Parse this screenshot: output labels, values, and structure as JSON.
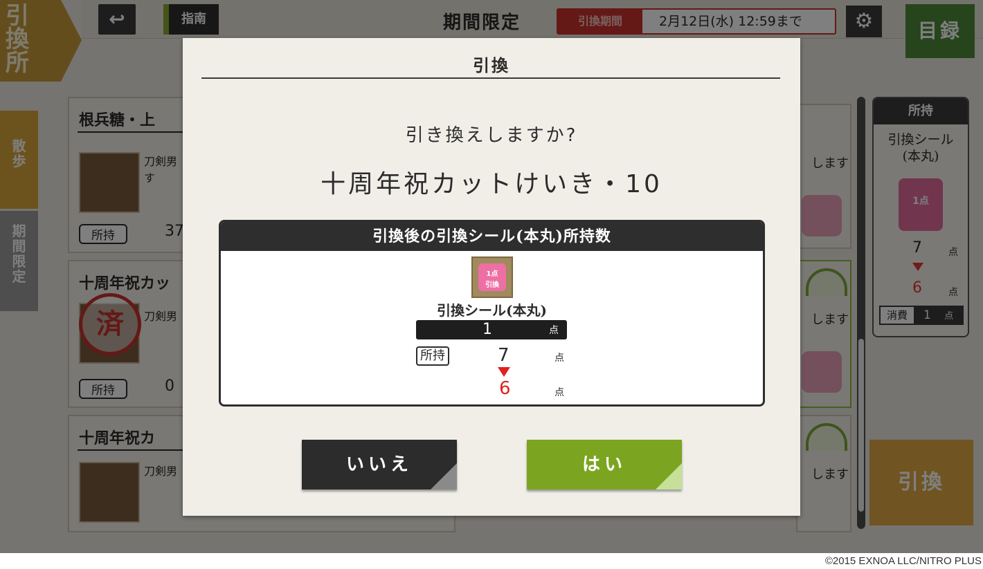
{
  "header": {
    "shop_emblem": "引換所",
    "guide_label": "指南",
    "limited_title": "期間限定",
    "period_label": "引換期間",
    "period_value": "2月12日(水) 12:59まで",
    "catalog_label": "目録"
  },
  "sidebar": {
    "walk_label": "散歩",
    "limited_label": "期間限定"
  },
  "background_cards": [
    {
      "title": "根兵糖・上",
      "desc": "刀剣男\nす",
      "owned_label": "所持",
      "owned_value": "37"
    },
    {
      "title": "十周年祝カッ",
      "desc": "刀剣男",
      "owned_label": "所持",
      "owned_value": "0",
      "stamp": "済"
    },
    {
      "title": "十周年祝カ",
      "desc": "刀剣男"
    }
  ],
  "background_right_text": [
    "します",
    "します",
    "します"
  ],
  "owned_panel": {
    "title": "所持",
    "item_name": "引換シール\n(本丸)",
    "icon_text": "1点",
    "before": "7",
    "after": "6",
    "unit": "点",
    "consume_label": "消費",
    "consume_value": "1",
    "consume_unit": "点"
  },
  "exchange_button": "引換",
  "modal": {
    "title": "引換",
    "question": "引き換えしますか?",
    "item_name": "十周年祝カットけいき・10",
    "result_header": "引換後の引換シール(本丸)所持数",
    "seal_icon_text": "1点\n引換",
    "seal_name": "引換シール(本丸)",
    "cost_value": "1",
    "cost_unit": "点",
    "owned_label": "所持",
    "before_value": "7",
    "before_unit": "点",
    "after_value": "6",
    "after_unit": "点",
    "no_label": "いいえ",
    "yes_label": "はい"
  },
  "colors": {
    "accent_green": "#7ba520",
    "warning_red": "#e0211f",
    "dark": "#2c2c2c"
  },
  "copyright": "©2015 EXNOA LLC/NITRO PLUS"
}
